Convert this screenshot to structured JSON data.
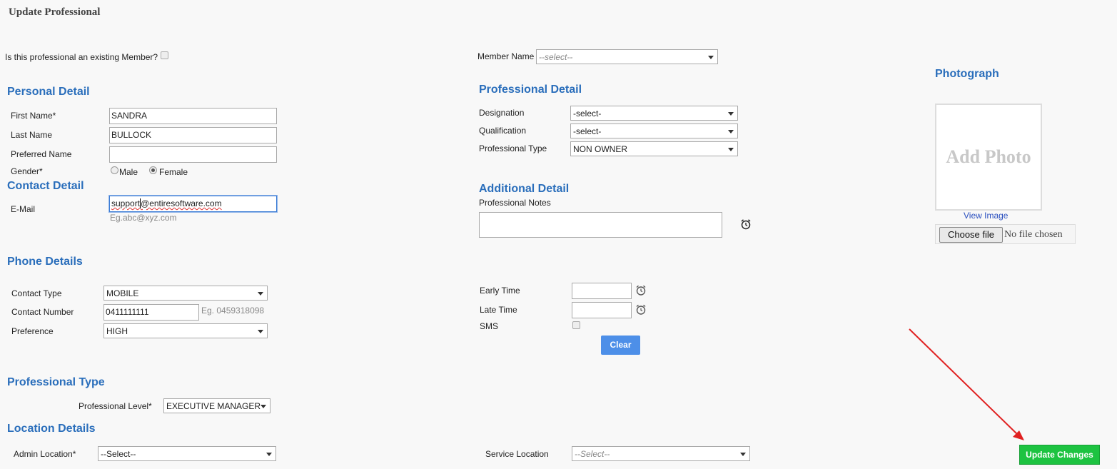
{
  "page": {
    "title": "Update Professional"
  },
  "member": {
    "existing_question": "Is this professional an existing Member?",
    "member_name_label": "Member Name",
    "member_name_placeholder": "--select--"
  },
  "personal": {
    "heading": "Personal Detail",
    "first_name_label": "First Name*",
    "first_name_value": "SANDRA",
    "last_name_label": "Last Name",
    "last_name_value": "BULLOCK",
    "preferred_name_label": "Preferred Name",
    "preferred_name_value": "",
    "gender_label": "Gender*",
    "gender_male": "Male",
    "gender_female": "Female",
    "gender_selected": "Female"
  },
  "contact": {
    "heading": "Contact Detail",
    "email_label": "E-Mail",
    "email_value_user": "support",
    "email_value_domain": "@entiresoftware.com",
    "email_hint": "Eg.abc@xyz.com"
  },
  "phone": {
    "heading": "Phone Details",
    "contact_type_label": "Contact Type",
    "contact_type_value": "MOBILE",
    "contact_number_label": "Contact Number",
    "contact_number_value": "0411111111",
    "contact_number_hint": "Eg. 0459318098",
    "preference_label": "Preference",
    "preference_value": "HIGH"
  },
  "professional_type": {
    "heading": "Professional Type",
    "level_label": "Professional Level*",
    "level_value": "EXECUTIVE MANAGER"
  },
  "location": {
    "heading": "Location Details",
    "admin_label": "Admin Location*",
    "admin_value": "--Select--",
    "service_label": "Service Location",
    "service_value": "--Select--"
  },
  "professional_detail": {
    "heading": "Professional Detail",
    "designation_label": "Designation",
    "designation_value": "-select-",
    "qualification_label": "Qualification",
    "qualification_value": "-select-",
    "type_label": "Professional Type",
    "type_value": "NON OWNER"
  },
  "additional": {
    "heading": "Additional Detail",
    "notes_label": "Professional Notes",
    "early_time_label": "Early Time",
    "late_time_label": "Late Time",
    "sms_label": "SMS",
    "clear_button": "Clear"
  },
  "photo": {
    "heading": "Photograph",
    "placeholder": "Add Photo",
    "view_link": "View Image",
    "choose_button": "Choose file",
    "no_file": "No file chosen"
  },
  "actions": {
    "update_button": "Update Changes"
  },
  "colors": {
    "heading": "#2a6ebb",
    "update_button": "#1dc341",
    "clear_button": "#4d8fe8",
    "annotation_arrow": "#e02020"
  }
}
